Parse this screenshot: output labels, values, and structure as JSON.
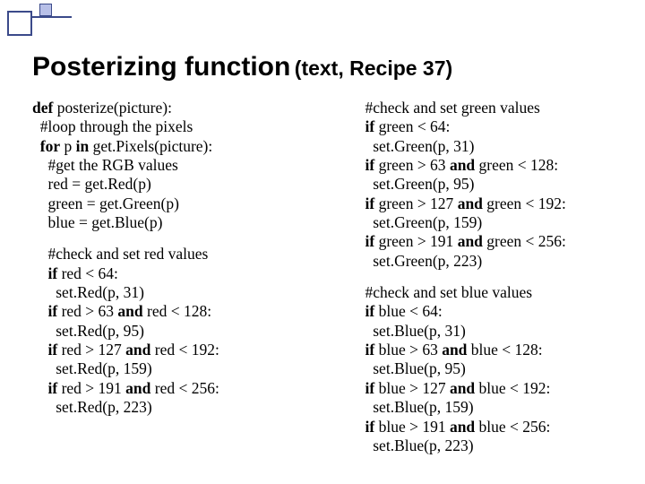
{
  "title": {
    "main": "Posterizing function",
    "sub": "(text, Recipe 37)"
  },
  "left": {
    "block1": {
      "l1a": "def",
      "l1b": " posterize(picture):",
      "l2": "  #loop through the pixels",
      "l3a": "  for",
      "l3b": " p ",
      "l3c": "in",
      "l3d": " get.Pixels(picture):",
      "l4": "    #get the RGB values",
      "l5": "    red = get.Red(p)",
      "l6": "    green = get.Green(p)",
      "l7": "    blue = get.Blue(p)"
    },
    "block2": {
      "l1": "    #check and set red values",
      "l2a": "    if",
      "l2b": " red < 64:",
      "l3": "      set.Red(p, 31)",
      "l4a": "    if",
      "l4b": " red > 63 ",
      "l4c": "and",
      "l4d": " red < 128:",
      "l5": "      set.Red(p, 95)",
      "l6a": "    if",
      "l6b": " red > 127 ",
      "l6c": "and",
      "l6d": " red < 192:",
      "l7": "      set.Red(p, 159)",
      "l8a": "    if",
      "l8b": " red > 191 ",
      "l8c": "and",
      "l8d": " red < 256:",
      "l9": "      set.Red(p, 223)"
    }
  },
  "right": {
    "block1": {
      "l1": "    #check and set green values",
      "l2a": "    if",
      "l2b": " green < 64:",
      "l3": "      set.Green(p, 31)",
      "l4a": "    if",
      "l4b": " green > 63 ",
      "l4c": "and",
      "l4d": " green < 128:",
      "l5": "      set.Green(p, 95)",
      "l6a": "    if",
      "l6b": " green > 127 ",
      "l6c": "and",
      "l6d": " green < 192:",
      "l7": "      set.Green(p, 159)",
      "l8a": "    if",
      "l8b": " green > 191 ",
      "l8c": "and",
      "l8d": " green < 256:",
      "l9": "      set.Green(p, 223)"
    },
    "block2": {
      "l1": "    #check and set blue values",
      "l2a": "    if",
      "l2b": " blue < 64:",
      "l3": "      set.Blue(p, 31)",
      "l4a": "    if",
      "l4b": " blue > 63 ",
      "l4c": "and",
      "l4d": " blue < 128:",
      "l5": "      set.Blue(p, 95)",
      "l6a": "    if",
      "l6b": " blue > 127 ",
      "l6c": "and",
      "l6d": " blue < 192:",
      "l7": "      set.Blue(p, 159)",
      "l8a": "    if",
      "l8b": " blue > 191 ",
      "l8c": "and",
      "l8d": " blue < 256:",
      "l9": "      set.Blue(p, 223)"
    }
  }
}
